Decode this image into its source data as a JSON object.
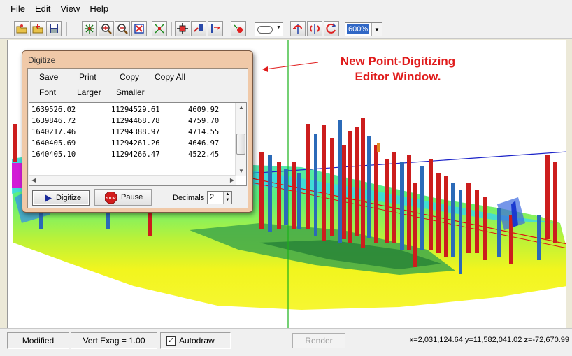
{
  "menu": [
    "File",
    "Edit",
    "View",
    "Help"
  ],
  "toolbar": {
    "zoom_value": "600%"
  },
  "annotation": {
    "line1": "New Point-Digitizing",
    "line2": "Editor Window."
  },
  "digitize": {
    "title": "Digitize",
    "buttons_row1": [
      "Save",
      "Print",
      "Copy",
      "Copy All"
    ],
    "buttons_row2": [
      "Font",
      "Larger",
      "Smaller"
    ],
    "rows": [
      {
        "x": "1639526.02",
        "y": "11294529.61",
        "z": "4609.92"
      },
      {
        "x": "1639846.72",
        "y": "11294468.78",
        "z": "4759.70"
      },
      {
        "x": "1640217.46",
        "y": "11294388.97",
        "z": "4714.55"
      },
      {
        "x": "1640405.69",
        "y": "11294261.26",
        "z": "4646.97"
      },
      {
        "x": "1640405.10",
        "y": "11294266.47",
        "z": "4522.45"
      }
    ],
    "digitize_label": "Digitize",
    "pause_label": "Pause",
    "stop_text": "STOP",
    "decimals_label": "Decimals",
    "decimals_value": "2"
  },
  "status": {
    "modified": "Modified",
    "vert_exag": "Vert Exag = 1.00",
    "autodraw": "Autodraw",
    "autodraw_checked": true,
    "render": "Render",
    "coords": "x=2,031,124.64 y=11,582,041.02 z=-72,670.99"
  },
  "colors": {
    "annotation": "#e01c1c",
    "digitize_frame": "#f0c9a8",
    "zoom_highlight": "#3168c6"
  }
}
